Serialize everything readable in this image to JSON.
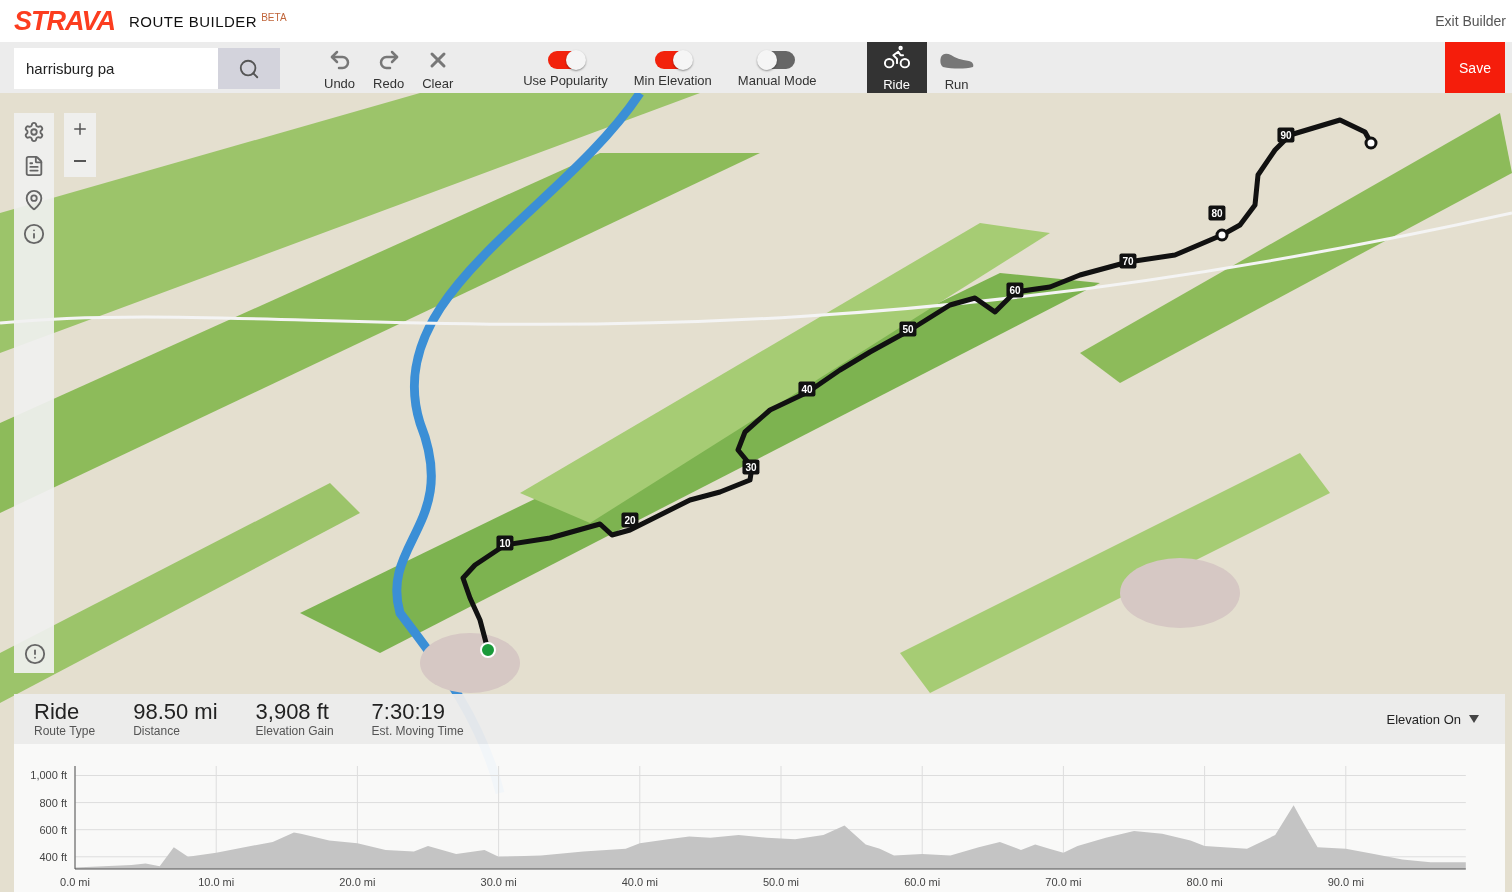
{
  "header": {
    "logo": "STRAVA",
    "title": "ROUTE BUILDER",
    "badge": "BETA",
    "exit_link": "Exit Builder"
  },
  "toolbar": {
    "search": {
      "value": "harrisburg pa"
    },
    "actions": [
      {
        "kind": "undo",
        "label": "Undo"
      },
      {
        "kind": "redo",
        "label": "Redo"
      },
      {
        "kind": "clear",
        "label": "Clear"
      }
    ],
    "toggles": [
      {
        "label": "Use Popularity",
        "on": true
      },
      {
        "label": "Min Elevation",
        "on": true
      },
      {
        "label": "Manual Mode",
        "on": false
      }
    ],
    "route_types": [
      {
        "kind": "ride",
        "label": "Ride",
        "selected": true
      },
      {
        "kind": "run",
        "label": "Run",
        "selected": false
      }
    ],
    "save_button": "Save"
  },
  "map": {
    "kind": "picture",
    "mile_markers": [
      "10",
      "20",
      "30",
      "40",
      "50",
      "60",
      "70",
      "80",
      "90"
    ],
    "sidebar": [
      {
        "kind": "settings"
      },
      {
        "kind": "list"
      },
      {
        "kind": "pin"
      },
      {
        "kind": "info"
      }
    ],
    "report_icon": {
      "kind": "alert"
    }
  },
  "summary": {
    "stats": [
      {
        "value": "Ride",
        "label": "Route Type"
      },
      {
        "value": "98.50 mi",
        "label": "Distance"
      },
      {
        "value": "3,908 ft",
        "label": "Elevation Gain"
      },
      {
        "value": "7:30:19",
        "label": "Est. Moving Time"
      }
    ],
    "elevation_toggle": "Elevation On"
  },
  "elevation_chart": {
    "chart_data": {
      "type": "area",
      "grid": true,
      "ylim": [
        310,
        1070
      ],
      "xlim": [
        0,
        98.5
      ],
      "xticks": [
        {
          "value": 0,
          "label": "0.0 mi"
        },
        {
          "value": 10,
          "label": "10.0 mi"
        },
        {
          "value": 20,
          "label": "20.0 mi"
        },
        {
          "value": 30,
          "label": "30.0 mi"
        },
        {
          "value": 40,
          "label": "40.0 mi"
        },
        {
          "value": 50,
          "label": "50.0 mi"
        },
        {
          "value": 60,
          "label": "60.0 mi"
        },
        {
          "value": 70,
          "label": "70.0 mi"
        },
        {
          "value": 80,
          "label": "80.0 mi"
        },
        {
          "value": 90,
          "label": "90.0 mi"
        }
      ],
      "yticks": [
        {
          "value": 400,
          "label": "400 ft"
        },
        {
          "value": 600,
          "label": "600 ft"
        },
        {
          "value": 800,
          "label": "800 ft"
        },
        {
          "value": 1000,
          "label": "1,000 ft"
        }
      ],
      "x": [
        0,
        2,
        4,
        5,
        6,
        7,
        8,
        10,
        12,
        14,
        15.5,
        16,
        18,
        20,
        22,
        24,
        25,
        27,
        29,
        30,
        33,
        36,
        39,
        40,
        42,
        43.5,
        45,
        47,
        49,
        51,
        53,
        54.5,
        56,
        57,
        58,
        60,
        62,
        64,
        65.5,
        67,
        68,
        69,
        70,
        71,
        73,
        75,
        77,
        79,
        80,
        83,
        85,
        86.3,
        87,
        88,
        90,
        92,
        94,
        96,
        98.5
      ],
      "series": [
        {
          "color": "#c4c4c4",
          "values": [
            320,
            330,
            340,
            350,
            330,
            470,
            400,
            430,
            470,
            510,
            580,
            570,
            520,
            500,
            450,
            440,
            480,
            420,
            450,
            400,
            410,
            440,
            460,
            500,
            530,
            550,
            540,
            560,
            540,
            530,
            560,
            630,
            490,
            460,
            410,
            420,
            410,
            470,
            510,
            450,
            490,
            460,
            430,
            480,
            540,
            590,
            570,
            520,
            480,
            460,
            560,
            780,
            650,
            470,
            460,
            420,
            380,
            360,
            360
          ]
        }
      ]
    }
  }
}
